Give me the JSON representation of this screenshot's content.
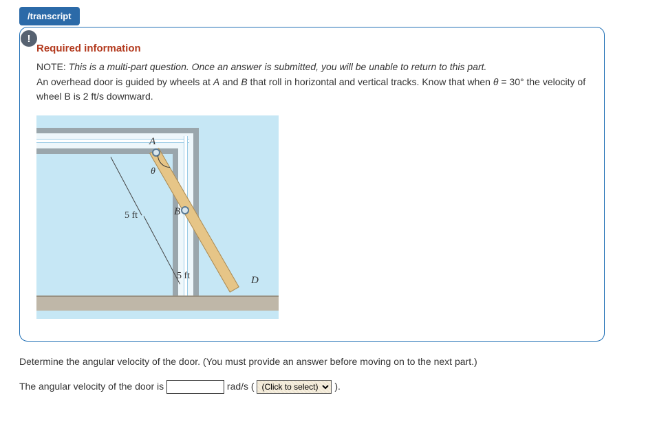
{
  "tab": {
    "label": "/transcript"
  },
  "alert": {
    "glyph": "!"
  },
  "info": {
    "req_title": "Required information",
    "note_label": "NOTE:",
    "note_text": "This is a multi-part question. Once an answer is submitted, you will be unable to return to this part.",
    "desc_pre": "An overhead door is guided by wheels at ",
    "desc_A": "A",
    "desc_mid1": " and ",
    "desc_B": "B",
    "desc_mid2": " that roll in horizontal and vertical tracks. Know that when ",
    "desc_theta": "θ",
    "desc_eq": " = 30° the velocity of wheel B is 2 ft/s downward."
  },
  "diagram": {
    "A": "A",
    "B": "B",
    "D": "D",
    "theta": "θ",
    "dim1": "5 ft",
    "dim2": "5 ft"
  },
  "question": {
    "prompt": "Determine the angular velocity of the door. (You must provide an answer before moving on to the next part.)",
    "answer_pre": "The angular velocity of the door is ",
    "unit": " rad/s ( ",
    "select_placeholder": "(Click to select)",
    "answer_post": " )."
  }
}
